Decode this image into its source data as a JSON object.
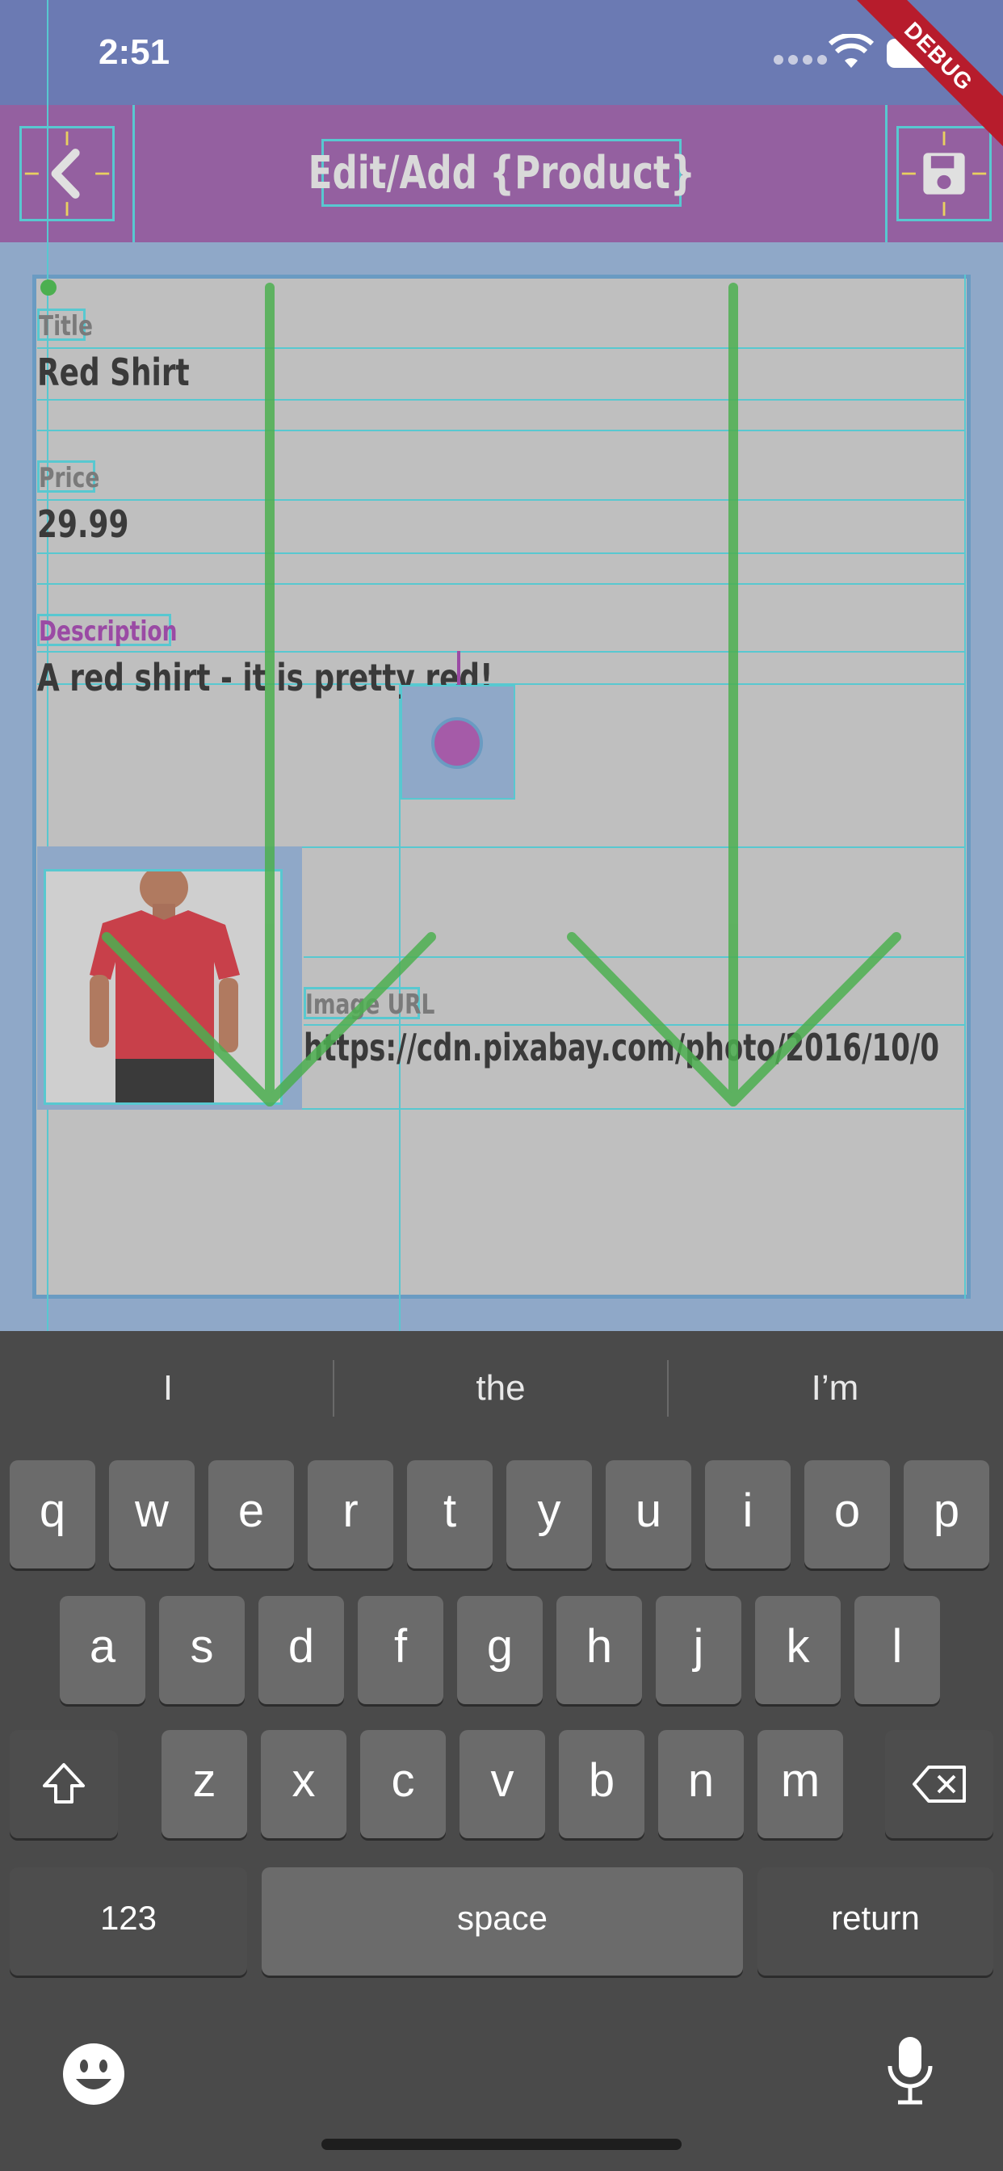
{
  "status_bar": {
    "time": "2:51"
  },
  "debug_banner": "DEBUG",
  "app_bar": {
    "title": "Edit/Add {Product}",
    "back_icon": "chevron-left-icon",
    "save_icon": "floppy-disk-icon"
  },
  "form": {
    "title": {
      "label": "Title",
      "value": "Red Shirt"
    },
    "price": {
      "label": "Price",
      "value": "29.99"
    },
    "description": {
      "label": "Description",
      "value": "A red shirt - it is pretty red!"
    },
    "image_url": {
      "label": "Image URL",
      "value": "https://cdn.pixabay.com/photo/2016/10/0"
    }
  },
  "keyboard": {
    "suggestions": [
      "I",
      "the",
      "I’m"
    ],
    "row1": [
      "q",
      "w",
      "e",
      "r",
      "t",
      "y",
      "u",
      "i",
      "o",
      "p"
    ],
    "row2": [
      "a",
      "s",
      "d",
      "f",
      "g",
      "h",
      "j",
      "k",
      "l"
    ],
    "row3": [
      "z",
      "x",
      "c",
      "v",
      "b",
      "n",
      "m"
    ],
    "numbers_key": "123",
    "space_key": "space",
    "return_key": "return"
  },
  "colors": {
    "app_bar": "#9460a0",
    "status_bar": "#6b7ab3",
    "accent_label": "#9a4aa4",
    "debug_guides": "#58c8d0",
    "arrows": "#4caf50"
  }
}
